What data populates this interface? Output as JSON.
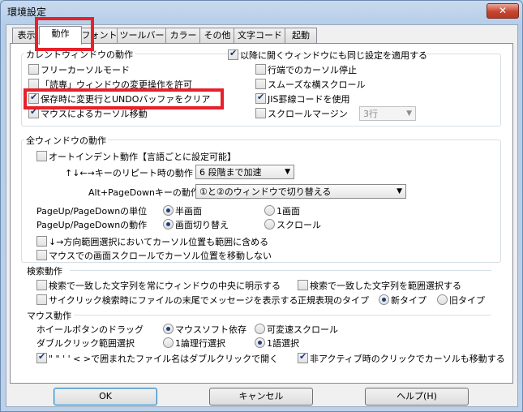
{
  "window": {
    "title": "環境設定",
    "close_label": "✕"
  },
  "tabs": [
    {
      "label": "表示"
    },
    {
      "label": "動作"
    },
    {
      "label": "フォント"
    },
    {
      "label": "ツールバー"
    },
    {
      "label": "カラー"
    },
    {
      "label": "その他"
    },
    {
      "label": "文字コード"
    },
    {
      "label": "起動"
    }
  ],
  "current_window": {
    "title": "カレントウィンドウの動作",
    "apply_future": {
      "label": "以降に開くウィンドウにも同じ設定を適用する",
      "checked": true
    },
    "free_cursor": {
      "label": "フリーカーソルモード",
      "checked": false
    },
    "allow_readonly": {
      "label": "「読専」ウィンドウの変更操作を許可",
      "checked": false
    },
    "mark_changes": {
      "label": "保存時に変更行とUNDOバッファをクリア",
      "checked": true
    },
    "mouse_cursor": {
      "label": "マウスによるカーソル移動",
      "checked": true
    },
    "line_end_stop": {
      "label": "行端でのカーソル停止",
      "checked": false
    },
    "smooth_scroll": {
      "label": "スムーズな横スクロール",
      "checked": false
    },
    "jis_ruled": {
      "label": "JIS罫線コードを使用",
      "checked": true
    },
    "scroll_margin": {
      "label": "スクロールマージン",
      "checked": false,
      "value": "3行"
    }
  },
  "all_windows": {
    "title": "全ウィンドウの動作",
    "auto_indent": {
      "label": "オートインデント動作【言語ごとに設定可能】",
      "checked": false
    },
    "repeat_label": "↑↓←→キーのリピート時の動作",
    "repeat_value": "6 段階まで加速",
    "altpgdn_label": "Alt+PageDownキーの動作",
    "altpgdn_value": "①と②のウィンドウで切り替える",
    "pageunit_label": "PageUp/PageDownの単位",
    "pageunit_opt1": "半画面",
    "pageunit_opt2": "1画面",
    "pageaction_label": "PageUp/PageDownの動作",
    "pageaction_opt1": "画面切り替え",
    "pageaction_opt2": "スクロール",
    "range_select": {
      "label": "↓→方向範囲選択においてカーソル位置も範囲に含める",
      "checked": false
    },
    "mouse_scroll": {
      "label": "マウスでの画面スクロールでカーソル位置を移動しない",
      "checked": false
    }
  },
  "search": {
    "title": "検索動作",
    "center": {
      "label": "検索で一致した文字列を常にウィンドウの中央に明示する",
      "checked": false
    },
    "cyclic": {
      "label": "サイクリック検索時にファイルの末尾でメッセージを表示する",
      "checked": false
    },
    "range": {
      "label": "検索で一致した文字列を範囲選択する",
      "checked": false
    },
    "regex_label": "正規表現のタイプ",
    "regex_opt1": "新タイプ",
    "regex_opt2": "旧タイプ"
  },
  "mouse": {
    "title": "マウス動作",
    "wheel_label": "ホイールボタンのドラッグ",
    "wheel_opt1": "マウスソフト依存",
    "wheel_opt2": "可変速スクロール",
    "dbl_label": "ダブルクリック範囲選択",
    "dbl_opt1": "1論理行選択",
    "dbl_opt2": "1語選択",
    "dbl_open": {
      "label": "\" \"  ' '  < >で囲まれたファイル名はダブルクリックで開く",
      "checked": true
    },
    "inactive_click": {
      "label": "非アクティブ時のクリックでカーソルも移動する",
      "checked": true
    }
  },
  "buttons": {
    "ok": "OK",
    "cancel": "キャンセル",
    "help": "ヘルプ(H)"
  }
}
